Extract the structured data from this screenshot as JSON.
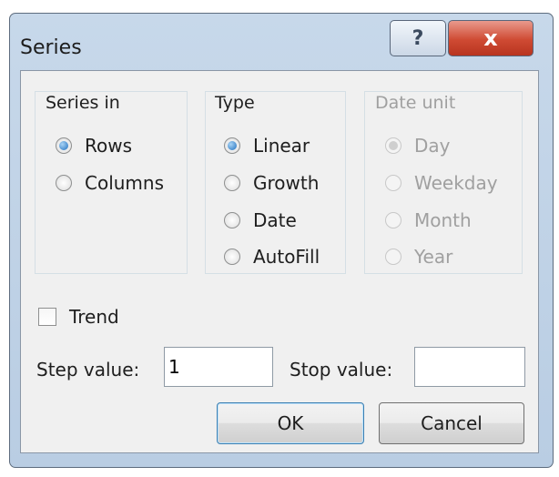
{
  "window": {
    "title": "Series"
  },
  "titlebar": {
    "help_label": "?",
    "close_label": "x"
  },
  "series_in": {
    "label": "Series in",
    "options": [
      {
        "label": "Rows",
        "selected": true
      },
      {
        "label": "Columns",
        "selected": false
      }
    ]
  },
  "type": {
    "label": "Type",
    "options": [
      {
        "label": "Linear",
        "selected": true
      },
      {
        "label": "Growth",
        "selected": false
      },
      {
        "label": "Date",
        "selected": false
      },
      {
        "label": "AutoFill",
        "selected": false
      }
    ]
  },
  "date_unit": {
    "label": "Date unit",
    "enabled": false,
    "options": [
      {
        "label": "Day",
        "selected": true
      },
      {
        "label": "Weekday",
        "selected": false
      },
      {
        "label": "Month",
        "selected": false
      },
      {
        "label": "Year",
        "selected": false
      }
    ]
  },
  "trend": {
    "label": "Trend",
    "checked": false
  },
  "step": {
    "label": "Step value:",
    "value": "1"
  },
  "stop": {
    "label": "Stop value:",
    "value": ""
  },
  "buttons": {
    "ok": "OK",
    "cancel": "Cancel"
  },
  "colors": {
    "frame": "#c7d8ea",
    "client": "#f0f0f0",
    "close": "#cf4a33",
    "accent": "#1f6fbf"
  }
}
